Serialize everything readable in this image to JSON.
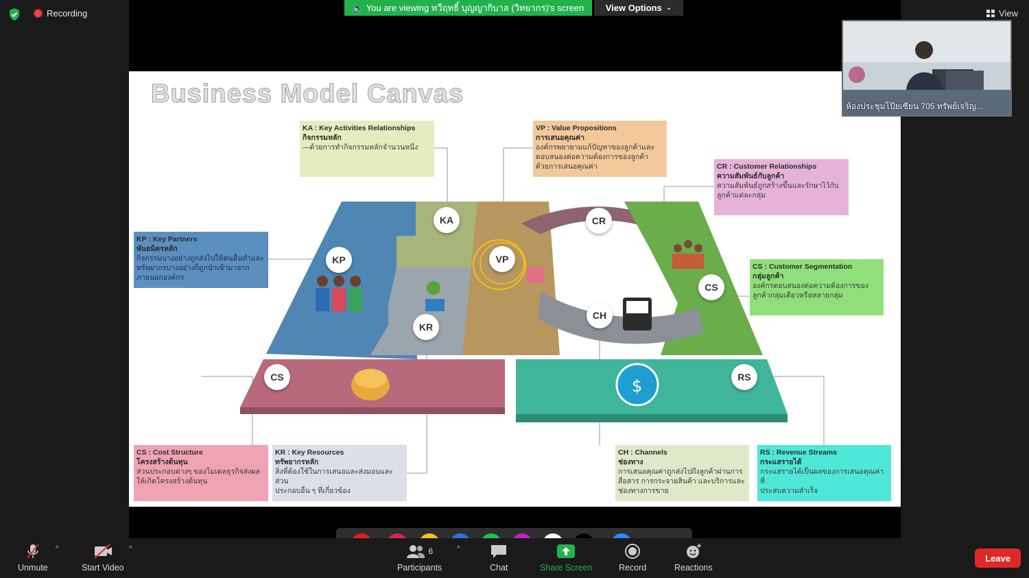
{
  "topbar": {
    "recording_label": "Recording",
    "viewing_text": "You are viewing ทวีฤทธิ์ บุญญากิบาล (วิทยากร)'s screen",
    "view_options_label": "View Options",
    "view_label": "View"
  },
  "slide": {
    "title": "Business Model Canvas",
    "circles": {
      "ka": "KA",
      "kp": "KP",
      "vp": "VP",
      "cr": "CR",
      "cs_top": "CS",
      "kr": "KR",
      "ch": "CH",
      "cs_cost": "CS",
      "rs": "RS"
    },
    "notes": {
      "ka": {
        "title": "KA : Key Activities Relationships",
        "thai": "กิจกรรมหลัก",
        "body": [
          "—ด้วยการทำกิจกรรมหลักจำนวนหนึ่ง"
        ]
      },
      "vp": {
        "title": "VP : Value Propositions",
        "thai": "การเสนอคุณค่า",
        "body": [
          "องค์กรพยายามแก้ปัญหาของลูกค้าและ",
          "ตอบสนองต่อความต้องการของลูกค้า",
          "ด้วยการเสนอคุณค่า"
        ]
      },
      "cr": {
        "title": "CR : Customer Relationships",
        "thai": "ความสัมพันธ์กับลูกค้า",
        "body": [
          "ความสัมพันธ์ถูกสร้างขึ้นและรักษาไว้กับ",
          "ลูกค้าแต่ละกลุ่ม"
        ]
      },
      "kp": {
        "title": "KP : Key Partners",
        "thai": "พันธมิตรหลัก",
        "body": [
          "กิจกรรมบางอย่างถูกส่งไปให้คนอื่นทำและ",
          "ทรัพยากรบางอย่างก็ถูกนำเข้ามาจาก",
          "ภายนอกองค์กร"
        ]
      },
      "cs": {
        "title": "CS : Customer Segmentation",
        "thai": "กลุ่มลูกค้า",
        "body": [
          "องค์กรตอบสนองต่อความต้องการของ",
          "ลูกค้ากลุ่มเดียวหรือหลายกลุ่ม"
        ]
      },
      "cost": {
        "title": "CS : Cost Structure",
        "thai": "โครงสร้างต้นทุน",
        "body": [
          "ส่วนประกอบต่างๆ ของโมเดลธุรกิจส่งผล",
          "ให้เกิดโครงสร้างต้นทุน"
        ]
      },
      "kr": {
        "title": "KR : Key Resources",
        "thai": "ทรัพยากรหลัก",
        "body": [
          "สิ่งที่ต้องใช้ในการเสนอและส่งมอบและส่วน",
          "ประกอบอื่น ๆ ที่เกี่ยวข้อง"
        ]
      },
      "ch": {
        "title": "CH : Channels",
        "thai": "ช่องทาง",
        "body": [
          "การเสนอคุณค่าถูกส่งไปถึงลูกค้าผ่านการ",
          "สื่อสาร การกระจายสินค้า และบริการและ",
          "ช่องทางการขาย"
        ]
      },
      "rs": {
        "title": "RS : Revenue Streams",
        "thai": "กระแสรายได้",
        "body": [
          "กระแสรายได้เป็นผลของการเสนอคุณค่าที่",
          "ประสบความสำเร็จ"
        ]
      }
    },
    "colors": {
      "kp": "#4f86b3",
      "ka": "#a7b57a",
      "kr": "#9aa5ad",
      "vp": "#b8975e",
      "cr": "#8e6470",
      "cs": "#6aad4a",
      "ch": "#8a9096",
      "cost": "#b86a7c",
      "rs": "#3fb59a"
    }
  },
  "selfview": {
    "name": "ห้องประชุมโป๊ยเซียน 705 ทรัพย์เจริญ..."
  },
  "toolbar": {
    "unmute": "Unmute",
    "start_video": "Start Video",
    "participants": "Participants",
    "participants_count": "6",
    "chat": "Chat",
    "share_screen": "Share Screen",
    "record": "Record",
    "reactions": "Reactions",
    "leave": "Leave"
  }
}
